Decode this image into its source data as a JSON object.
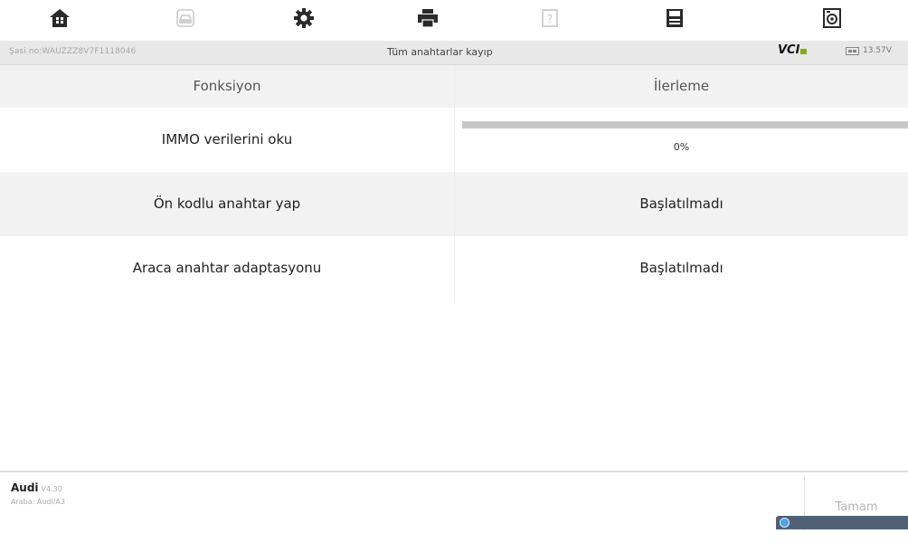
{
  "toolbar": {
    "buttons": [
      {
        "icon": "home-icon"
      },
      {
        "icon": "car-icon"
      },
      {
        "icon": "gear-icon"
      },
      {
        "icon": "printer-icon"
      },
      {
        "icon": "help-icon"
      },
      {
        "icon": "save-icon"
      },
      {
        "icon": "data-logging-icon"
      }
    ]
  },
  "status": {
    "vin": "Şasi no:WAUZZZ8V7F1118046",
    "title": "Tüm anahtarlar kayıp",
    "vci_label": "VCI",
    "voltage": "13.57V",
    "vci_color": "#7ab317"
  },
  "table": {
    "headers": {
      "function": "Fonksiyon",
      "progress": "İlerleme"
    },
    "rows": [
      {
        "function": "IMMO verilerini oku",
        "progress_percent": 0,
        "progress_text": "0%"
      },
      {
        "function": "Ön kodlu anahtar yap",
        "status": "Başlatılmadı"
      },
      {
        "function": "Araca anahtar adaptasyonu",
        "status": "Başlatılmadı"
      }
    ]
  },
  "footer": {
    "make": "Audi",
    "version": "V4.30",
    "vehicle": "Araba: Audi/A3",
    "ok_button": "Tamam"
  },
  "colors": {
    "accent": "#2b87d1",
    "header_bg": "#e8e8e8"
  }
}
